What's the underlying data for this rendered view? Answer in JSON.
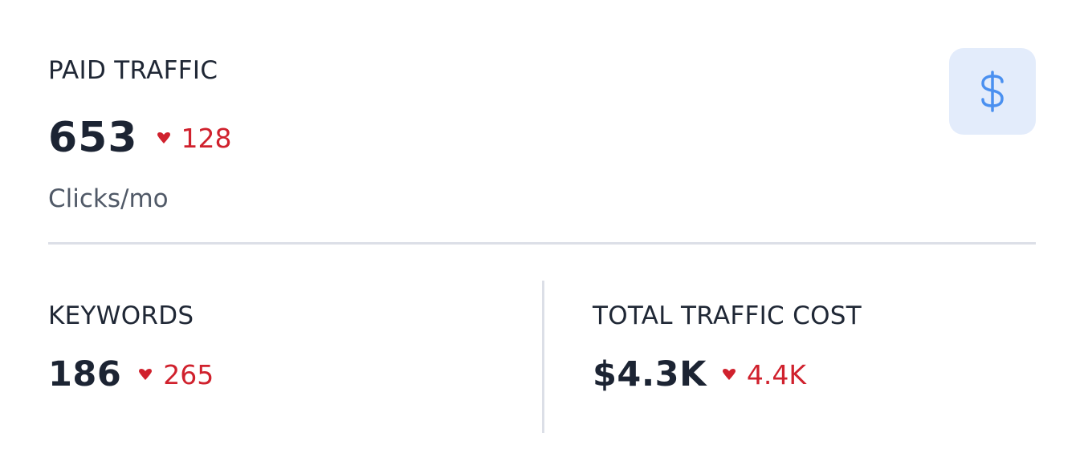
{
  "paid_traffic": {
    "title": "PAID TRAFFIC",
    "value": "653",
    "change": "128",
    "change_direction": "down",
    "unit": "Clicks/mo",
    "icon": "dollar-icon"
  },
  "keywords": {
    "title": "KEYWORDS",
    "value": "186",
    "change": "265",
    "change_direction": "down"
  },
  "total_traffic_cost": {
    "title": "TOTAL TRAFFIC COST",
    "value": "$4.3K",
    "change": "4.4K",
    "change_direction": "down"
  },
  "colors": {
    "negative": "#d0212d",
    "icon_accent": "#4a90f0",
    "icon_tile_bg": "#e3ecfb",
    "divider": "#dcdfe7"
  }
}
